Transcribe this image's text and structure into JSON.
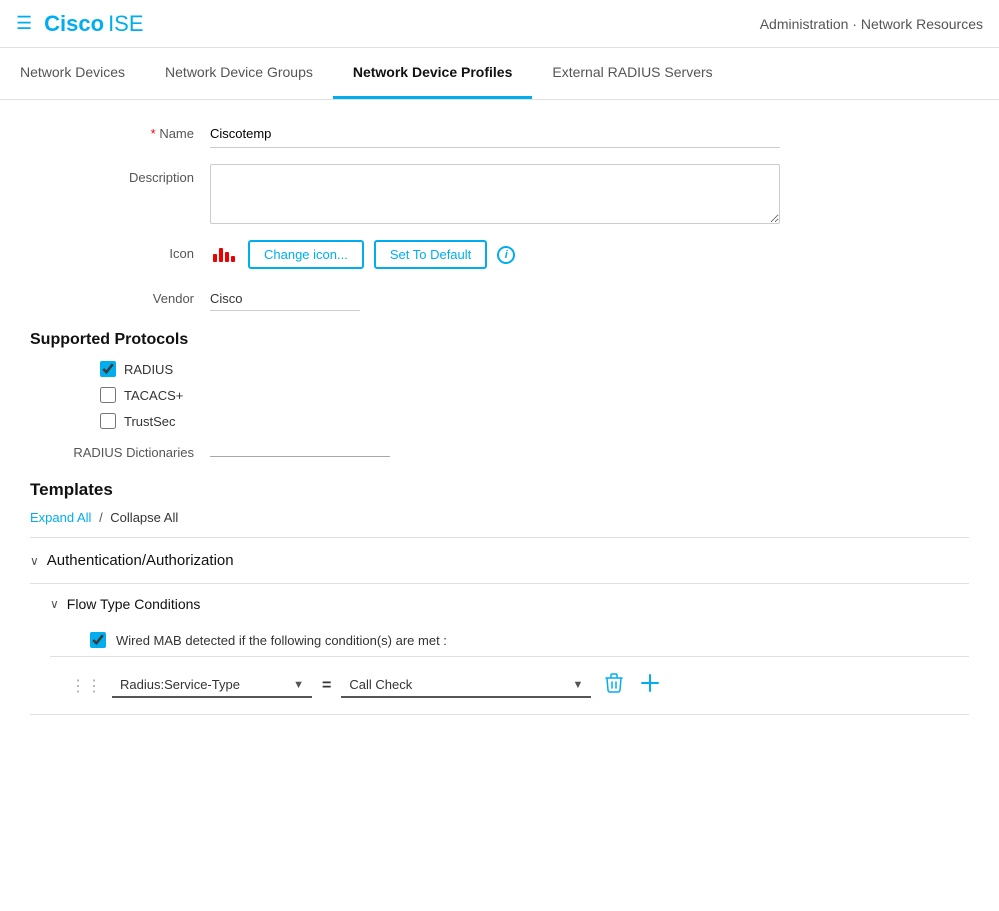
{
  "header": {
    "menu_icon": "☰",
    "logo_cisco": "Cisco",
    "logo_ise": "ISE",
    "breadcrumb": "Administration · Network Resources"
  },
  "nav": {
    "tabs": [
      {
        "id": "network-devices",
        "label": "Network Devices",
        "active": false
      },
      {
        "id": "network-device-groups",
        "label": "Network Device Groups",
        "active": false
      },
      {
        "id": "network-device-profiles",
        "label": "Network Device Profiles",
        "active": true
      },
      {
        "id": "external-radius-servers",
        "label": "External RADIUS Servers",
        "active": false
      }
    ]
  },
  "form": {
    "name_label": "* Name",
    "name_value": "Ciscotemp",
    "description_label": "Description",
    "description_placeholder": "",
    "icon_label": "Icon",
    "change_icon_btn": "Change icon...",
    "set_default_btn": "Set To Default",
    "vendor_label": "Vendor",
    "vendor_value": "Cisco"
  },
  "supported_protocols": {
    "title": "Supported Protocols",
    "radius_label": "RADIUS",
    "radius_checked": true,
    "tacacs_label": "TACACS+",
    "tacacs_checked": false,
    "trustsec_label": "TrustSec",
    "trustsec_checked": false,
    "dictionaries_label": "RADIUS Dictionaries"
  },
  "templates": {
    "title": "Templates",
    "expand_all": "Expand All",
    "separator": "/",
    "collapse_all": "Collapse All",
    "accordion": [
      {
        "id": "auth-authz",
        "label": "Authentication/Authorization",
        "expanded": true
      },
      {
        "id": "flow-type",
        "label": "Flow Type Conditions",
        "expanded": true
      }
    ],
    "wired_mab_label": "Wired MAB detected if the following condition(s) are met :",
    "wired_mab_checked": true,
    "condition": {
      "service_type_label": "Radius:Service-Type",
      "equals": "=",
      "value_label": "Call Check"
    }
  }
}
